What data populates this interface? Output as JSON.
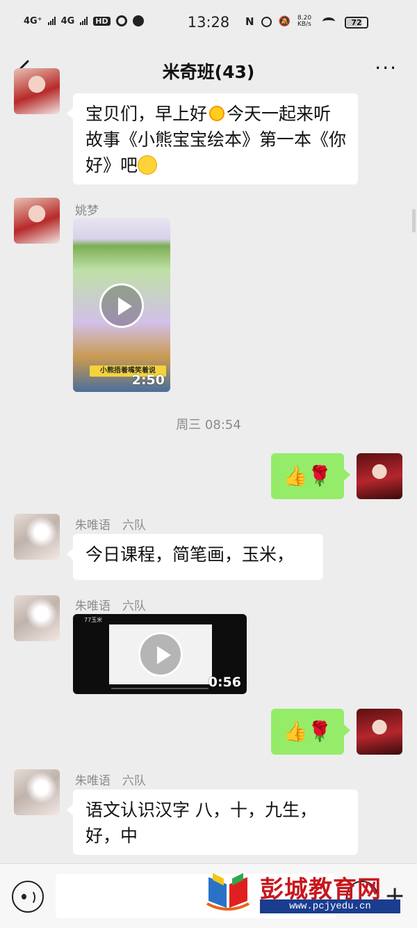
{
  "status_bar": {
    "network_1": "4G⁺",
    "network_2": "4G",
    "hd_badge": "HD",
    "time": "13:28",
    "speed": "8.20\nKB/s",
    "battery": "72"
  },
  "header": {
    "title": "米奇班(43)",
    "more": "···"
  },
  "messages": [
    {
      "sender": "",
      "text_part1": "宝贝们，早上好",
      "text_part2": "今天一起来听故事《小熊宝宝绘本》第一本《你好》吧",
      "emoji_1": "sun-emoji",
      "emoji_2": "smile-emoji"
    },
    {
      "sender": "姚梦",
      "video_duration": "2:50",
      "video_caption": "小熊捂着嘴笑着说"
    },
    {
      "timestamp": "周三 08:54"
    },
    {
      "sender": "self",
      "text": "👍🌹"
    },
    {
      "sender": "朱唯语　六队",
      "text": "今日课程，简笔画，玉米，"
    },
    {
      "sender": "朱唯语　六队",
      "video_duration": "0:56",
      "video_title": "77玉米"
    },
    {
      "sender": "self",
      "text": "👍🌹"
    },
    {
      "sender": "朱唯语　六队",
      "text": "语文认识汉字 八，十，九生，好，中"
    }
  ],
  "watermark": {
    "name": "彭城教育网",
    "url": "www.pcjyedu.cn"
  },
  "colors": {
    "bg": "#ededed",
    "bubble_self": "#95ec69",
    "bubble_other": "#ffffff",
    "watermark_red": "#c8161d",
    "watermark_blue": "#1a3d8f"
  }
}
